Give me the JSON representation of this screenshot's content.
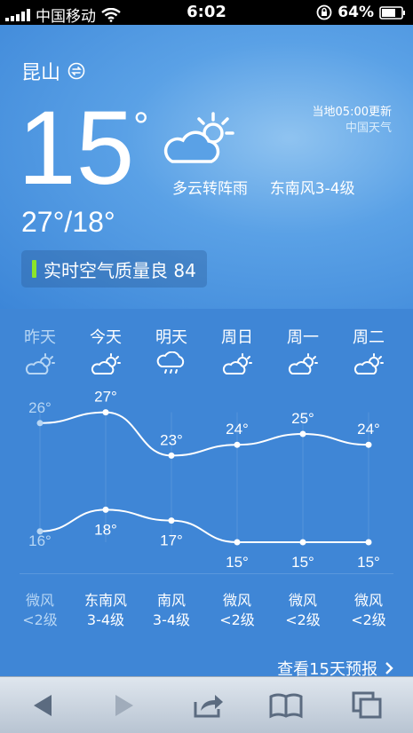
{
  "status": {
    "carrier": "中国移动",
    "time": "6:02",
    "battery": "64%"
  },
  "city": {
    "name": "昆山",
    "icon": "switch-icon"
  },
  "now": {
    "temp": "15",
    "deg": "°",
    "condition": "多云转阵雨",
    "wind": "东南风3-4级",
    "range": "27°/18°"
  },
  "update": {
    "time": "当地05:00更新",
    "source": "中国天气"
  },
  "aqi": {
    "label": "实时空气质量良 84",
    "color": "#8ce52a"
  },
  "forecast": {
    "days": [
      "昨天",
      "今天",
      "明天",
      "周日",
      "周一",
      "周二"
    ],
    "icons": [
      "cloud-sun-icon",
      "cloud-sun-icon",
      "rain-cloud-icon",
      "cloud-sun-icon",
      "cloud-sun-icon",
      "cloud-sun-icon"
    ],
    "high": [
      "26°",
      "27°",
      "23°",
      "24°",
      "25°",
      "24°"
    ],
    "low": [
      "16°",
      "18°",
      "17°",
      "15°",
      "15°",
      "15°"
    ],
    "wind_dir": [
      "微风",
      "东南风",
      "南风",
      "微风",
      "微风",
      "微风"
    ],
    "wind_level": [
      "<2级",
      "3-4级",
      "3-4级",
      "<2级",
      "<2级",
      "<2级"
    ],
    "more": "查看15天预报"
  },
  "chart_data": {
    "type": "line",
    "categories": [
      "昨天",
      "今天",
      "明天",
      "周日",
      "周一",
      "周二"
    ],
    "series": [
      {
        "values": [
          26,
          27,
          23,
          24,
          25,
          24
        ]
      },
      {
        "values": [
          16,
          18,
          17,
          15,
          15,
          15
        ]
      }
    ]
  },
  "toolbar": {
    "buttons": [
      "back-icon",
      "forward-icon",
      "share-icon",
      "bookmarks-icon",
      "tabs-icon"
    ]
  }
}
